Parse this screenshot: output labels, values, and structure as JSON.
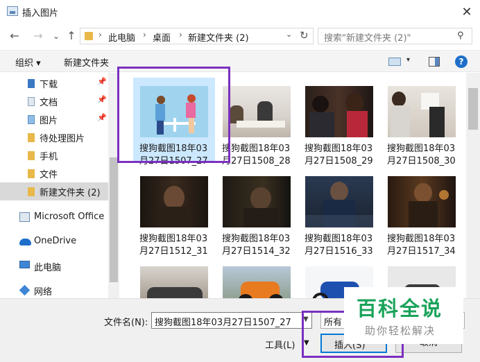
{
  "window": {
    "title": "插入图片",
    "close_glyph": "✕"
  },
  "nav": {
    "back_glyph": "←",
    "forward_glyph": "→",
    "dropdown_glyph": "⌄",
    "up_glyph": "↑",
    "breadcrumb": [
      "此电脑",
      "桌面",
      "新建文件夹 (2)"
    ],
    "crumb_sep": "›",
    "refresh_glyph": "↻",
    "search_placeholder": "搜索\"新建文件夹 (2)\"",
    "search_glyph": "⚲"
  },
  "toolbar": {
    "organize_label": "组织 ▾",
    "new_folder_label": "新建文件夹",
    "view_drop_glyph": "▾",
    "help_glyph": "?"
  },
  "sidebar": {
    "quick_items": [
      {
        "label": "下载",
        "pin": "📌"
      },
      {
        "label": "文档",
        "pin": "📌"
      },
      {
        "label": "图片",
        "pin": "📌"
      },
      {
        "label": "待处理图片"
      },
      {
        "label": "手机"
      },
      {
        "label": "文件"
      },
      {
        "label": "新建文件夹 (2)",
        "selected": true
      }
    ],
    "roots": [
      {
        "label": "Microsoft Office",
        "icon": "office-icon"
      },
      {
        "label": "OneDrive",
        "icon": "onedrive-cloud-icon"
      },
      {
        "label": "此电脑",
        "icon": "computer-icon"
      },
      {
        "label": "网络",
        "icon": "network-icon"
      }
    ]
  },
  "files": [
    {
      "line1": "搜狗截图18年03",
      "line2": "月27日1507_27",
      "selected": true
    },
    {
      "line1": "搜狗截图18年03",
      "line2": "月27日1508_28"
    },
    {
      "line1": "搜狗截图18年03",
      "line2": "月27日1508_29"
    },
    {
      "line1": "搜狗截图18年03",
      "line2": "月27日1508_30"
    },
    {
      "line1": "搜狗截图18年03",
      "line2": "月27日1512_31"
    },
    {
      "line1": "搜狗截图18年03",
      "line2": "月27日1514_32"
    },
    {
      "line1": "搜狗截图18年03",
      "line2": "月27日1516_33"
    },
    {
      "line1": "搜狗截图18年03",
      "line2": "月27日1517_34"
    }
  ],
  "bottom": {
    "filename_label": "文件名(N):",
    "filename_value": "搜狗截图18年03月27日1507_27",
    "filetype_value": "所有",
    "tools_label": "工具(L)",
    "drop_glyph": "▼",
    "insert_label": "插入(S)",
    "cancel_label": "取消"
  },
  "watermark": {
    "title": "百科全说",
    "subtitle": "助你轻松解决"
  },
  "colors": {
    "accent": "#0078d7",
    "highlight": "#7b2fbf",
    "watermark": "#1aa35a",
    "selected_tile": "#cce8ff"
  }
}
